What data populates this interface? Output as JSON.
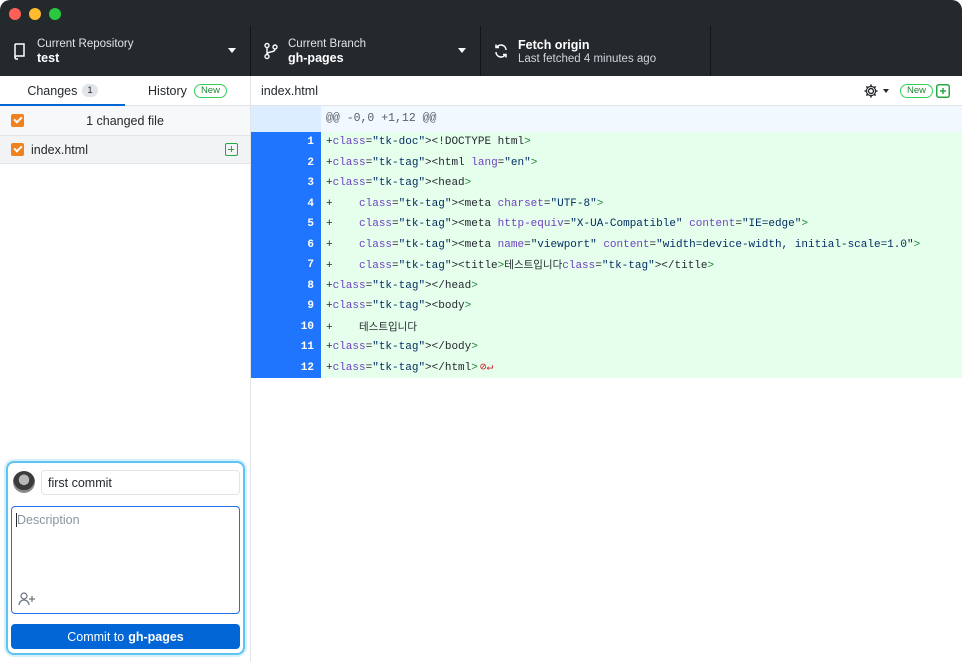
{
  "window": {
    "traffic_lights": [
      "close",
      "minimize",
      "zoom"
    ]
  },
  "toolbar": {
    "repo_label": "Current Repository",
    "repo_value": "test",
    "branch_label": "Current Branch",
    "branch_value": "gh-pages",
    "fetch_title": "Fetch origin",
    "fetch_sub": "Last fetched 4 minutes ago"
  },
  "sidebar": {
    "tabs": [
      {
        "label": "Changes",
        "badge": "1",
        "active": true
      },
      {
        "label": "History",
        "badge": "New",
        "active": false
      }
    ],
    "changed_header": "1 changed file",
    "files": [
      {
        "name": "index.html",
        "status": "added",
        "checked": true
      }
    ]
  },
  "commit": {
    "summary": "first commit",
    "description_placeholder": "Description",
    "button_prefix": "Commit to",
    "button_branch": "gh-pages"
  },
  "diff": {
    "path": "index.html",
    "new_badge": "New",
    "hunk_header": "@@ -0,0 +1,12 @@",
    "lines": [
      {
        "n": "1",
        "text": "+<!DOCTYPE html>"
      },
      {
        "n": "2",
        "text": "+<html lang=\"en\">"
      },
      {
        "n": "3",
        "text": "+<head>"
      },
      {
        "n": "4",
        "text": "+    <meta charset=\"UTF-8\">"
      },
      {
        "n": "5",
        "text": "+    <meta http-equiv=\"X-UA-Compatible\" content=\"IE=edge\">"
      },
      {
        "n": "6",
        "text": "+    <meta name=\"viewport\" content=\"width=device-width, initial-scale=1.0\">"
      },
      {
        "n": "7",
        "text": "+    <title>테스트입니다</title>"
      },
      {
        "n": "8",
        "text": "+</head>"
      },
      {
        "n": "9",
        "text": "+<body>"
      },
      {
        "n": "10",
        "text": "+    테스트입니다"
      },
      {
        "n": "11",
        "text": "+</body>"
      },
      {
        "n": "12",
        "text": "+</html>"
      }
    ]
  }
}
